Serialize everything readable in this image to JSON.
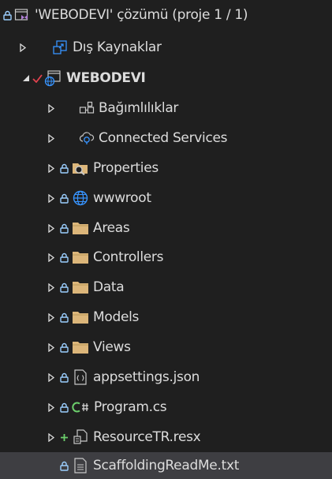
{
  "solution_explorer": {
    "items": [
      {
        "label": "'WEBODEVI' çözümü (proje 1 / 1)",
        "icon": "solution-icon",
        "status": "lock",
        "expander": "none",
        "bold": false,
        "selected": false
      },
      {
        "label": "Dış Kaynaklar",
        "icon": "external-sources-icon",
        "status": "none",
        "expander": "collapsed",
        "bold": false,
        "selected": false
      },
      {
        "label": "WEBODEVI",
        "icon": "web-project-icon",
        "status": "check",
        "expander": "expanded",
        "bold": true,
        "selected": false
      },
      {
        "label": "Bağımlılıklar",
        "icon": "dependencies-icon",
        "status": "none",
        "expander": "collapsed",
        "bold": false,
        "selected": false
      },
      {
        "label": "Connected Services",
        "icon": "connected-services-icon",
        "status": "none",
        "expander": "collapsed",
        "bold": false,
        "selected": false
      },
      {
        "label": "Properties",
        "icon": "properties-folder-icon",
        "status": "lock",
        "expander": "collapsed",
        "bold": false,
        "selected": false
      },
      {
        "label": "wwwroot",
        "icon": "globe-icon",
        "status": "lock",
        "expander": "collapsed",
        "bold": false,
        "selected": false
      },
      {
        "label": "Areas",
        "icon": "folder-icon",
        "status": "lock",
        "expander": "collapsed",
        "bold": false,
        "selected": false
      },
      {
        "label": "Controllers",
        "icon": "folder-icon",
        "status": "lock",
        "expander": "collapsed",
        "bold": false,
        "selected": false
      },
      {
        "label": "Data",
        "icon": "folder-icon",
        "status": "lock",
        "expander": "collapsed",
        "bold": false,
        "selected": false
      },
      {
        "label": "Models",
        "icon": "folder-icon",
        "status": "lock",
        "expander": "collapsed",
        "bold": false,
        "selected": false
      },
      {
        "label": "Views",
        "icon": "folder-icon",
        "status": "lock",
        "expander": "collapsed",
        "bold": false,
        "selected": false
      },
      {
        "label": "appsettings.json",
        "icon": "json-file-icon",
        "status": "lock",
        "expander": "collapsed",
        "bold": false,
        "selected": false
      },
      {
        "label": "Program.cs",
        "icon": "csharp-file-icon",
        "status": "lock",
        "expander": "collapsed",
        "bold": false,
        "selected": false
      },
      {
        "label": "ResourceTR.resx",
        "icon": "resx-file-icon",
        "status": "plus",
        "expander": "collapsed",
        "bold": false,
        "selected": false
      },
      {
        "label": "ScaffoldingReadMe.txt",
        "icon": "text-file-icon",
        "status": "lock",
        "expander": "none",
        "bold": false,
        "selected": true
      }
    ]
  },
  "colors": {
    "background": "#1f1f1f",
    "selection": "#3e3e42",
    "text": "#dcdcdc",
    "lock": "#9ccfff",
    "check": "#e0424e",
    "plus": "#6ccf6c",
    "folder": "#dcb67a",
    "accent": "#3794ff"
  }
}
